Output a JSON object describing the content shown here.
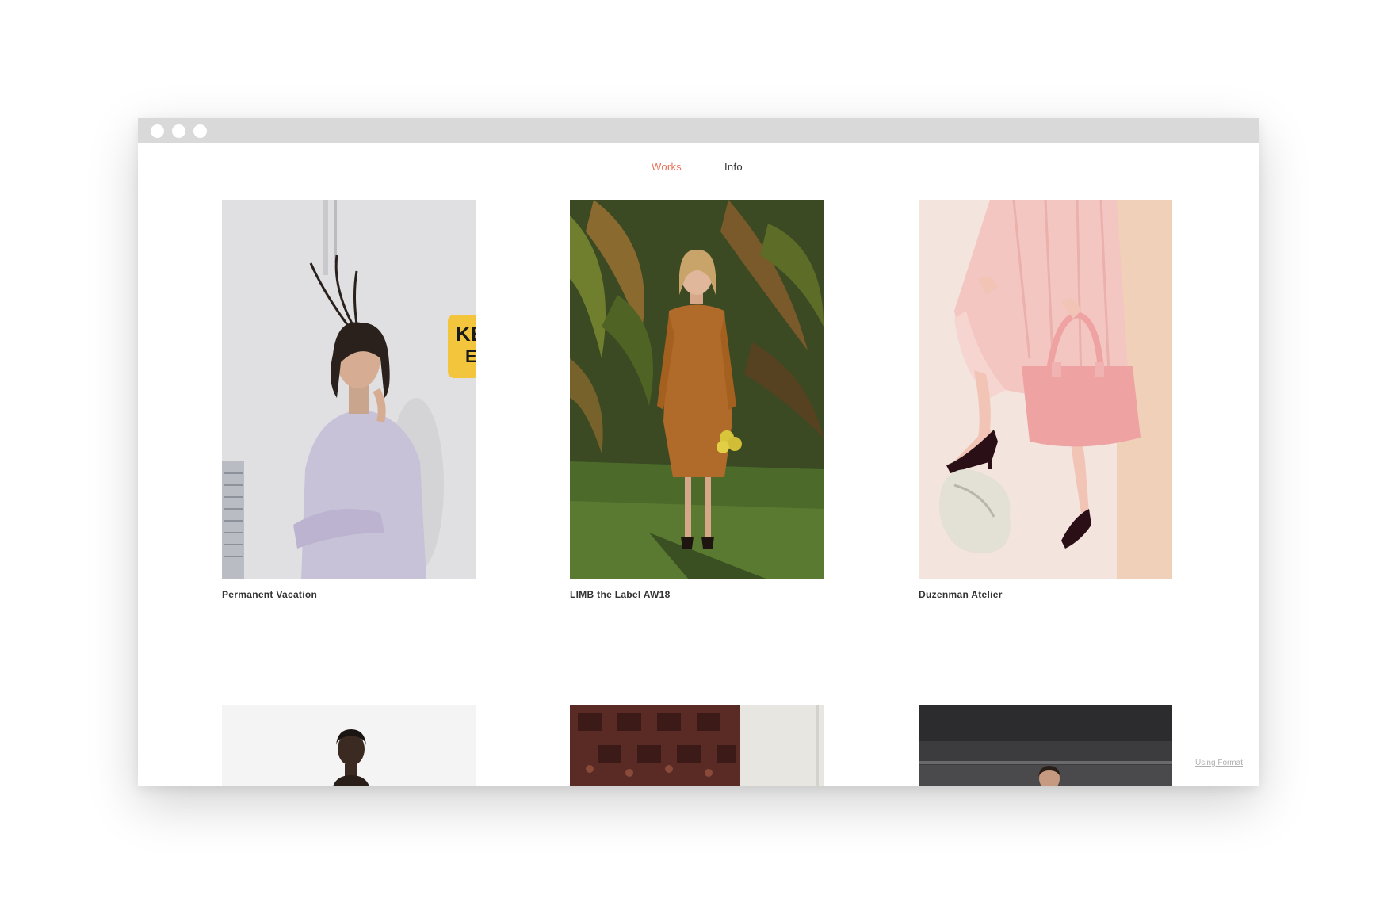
{
  "nav": {
    "works": "Works",
    "info": "Info"
  },
  "projects": [
    {
      "title": "Permanent Vacation"
    },
    {
      "title": "LIMB the Label AW18"
    },
    {
      "title": "Duzenman Atelier"
    }
  ],
  "footer": {
    "using_format": "Using Format"
  },
  "colors": {
    "accent": "#e8735a",
    "titlebar": "#d9d9d9"
  }
}
